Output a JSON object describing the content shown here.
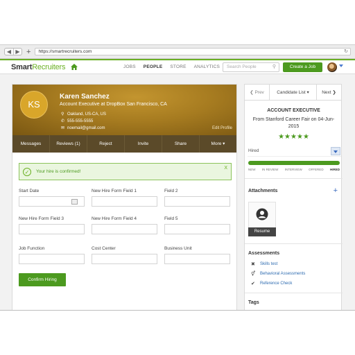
{
  "browser": {
    "url": "https://smartrecruiters.com",
    "back": "◀",
    "forward": "▶",
    "new_tab": "+",
    "reload_icon": "reload-icon"
  },
  "app": {
    "logo_part1": "Smart",
    "logo_part2": "Recruiters",
    "nav": [
      "JOBS",
      "PEOPLE",
      "STORE",
      "ANALYTICS"
    ],
    "active_nav": "PEOPLE",
    "search_placeholder": "Search People",
    "create_job": "Create a Job",
    "accent_color": "#4c9a1f"
  },
  "candidate": {
    "initials": "KS",
    "name": "Karen Sanchez",
    "title": "Account Executive at DropBox San Francisco, CA",
    "location": "Oakland, US-CA, US",
    "phone": "555-555-5555",
    "email": "noemail@gmail.com",
    "edit_profile": "Edit Profile"
  },
  "actions": [
    "Messages",
    "Reviews (1)",
    "Reject",
    "Invite",
    "Share",
    "More ▾"
  ],
  "confirmation": {
    "message": "Your hire is confirmed!",
    "close": "X"
  },
  "form": {
    "fields": [
      {
        "label": "Start Date",
        "value": ""
      },
      {
        "label": "New Hire Form Field 1",
        "value": ""
      },
      {
        "label": "Field 2",
        "value": ""
      },
      {
        "label": "New Hire Form Field 3",
        "value": ""
      },
      {
        "label": "New Hire Form Field 4",
        "value": ""
      },
      {
        "label": "Field 5",
        "value": ""
      },
      {
        "label": "Job Function",
        "value": ""
      },
      {
        "label": "Cost Center",
        "value": ""
      },
      {
        "label": "Business Unit",
        "value": ""
      }
    ],
    "submit": "Confirm Hiring"
  },
  "pager": {
    "prev": "❮ Prev",
    "list": "Candidate List ▾",
    "next": "Next ❯"
  },
  "job": {
    "title": "ACCOUNT EXECUTIVE",
    "source": "From Stanford Career Fair on 04-Jun-2015",
    "rating": 5,
    "stars": "★★★★★",
    "stage": "Hired",
    "stages": [
      "NEW",
      "IN REVIEW",
      "INTERVIEW",
      "OFFERED",
      "HIRED"
    ],
    "current_stage": "HIRED",
    "progress": 1.0
  },
  "attachments": {
    "title": "Attachments",
    "add": "+",
    "resume_label": "Resume"
  },
  "assessments": {
    "title": "Assessments",
    "items": [
      {
        "icon": "✖",
        "label": "Skills test"
      },
      {
        "icon": "⚥",
        "label": "Behavioral Assessments"
      },
      {
        "icon": "✔",
        "label": "Reference Check"
      }
    ]
  },
  "tags": {
    "title": "Tags"
  }
}
